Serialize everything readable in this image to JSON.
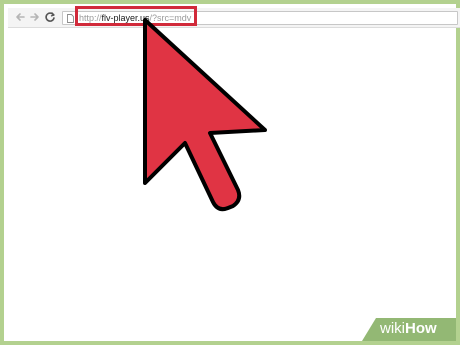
{
  "browser": {
    "url_prefix": "http://",
    "url_host": "flv-player.us",
    "url_path": "/?src=mdv"
  },
  "icons": {
    "back": "back-arrow-icon",
    "forward": "forward-arrow-icon",
    "reload": "reload-icon",
    "page": "page-icon",
    "cursor": "mouse-pointer-icon"
  },
  "colors": {
    "frame": "#b3d18f",
    "highlight": "#d12a3a",
    "cursor_fill": "#e03444",
    "cursor_outline": "#000000"
  },
  "watermark": {
    "wiki": "wiki",
    "how": "How"
  }
}
